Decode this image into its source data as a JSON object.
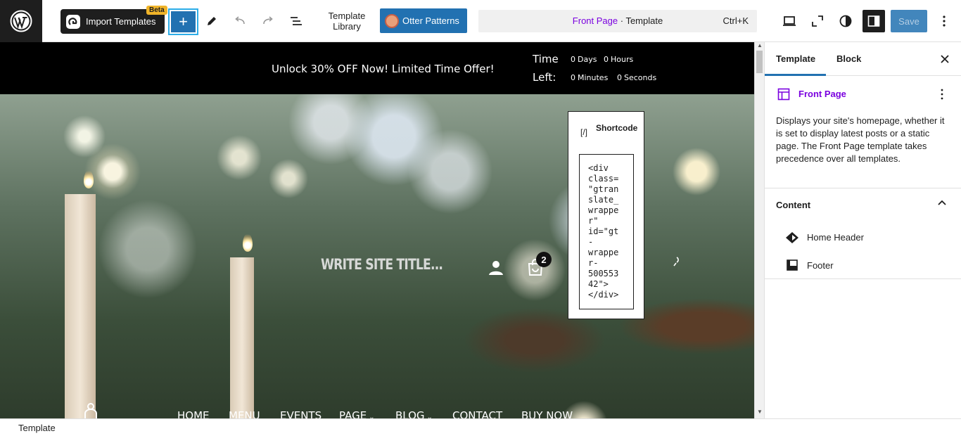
{
  "toolbar": {
    "import_label": "Import Templates",
    "beta_badge": "Beta",
    "template_library_line1": "Template",
    "template_library_line2": "Library",
    "otter_label": "Otter Patterns",
    "command": {
      "page": "Front Page",
      "separator": " · ",
      "type": "Template",
      "shortcut": "Ctrl+K"
    },
    "save_label": "Save"
  },
  "canvas": {
    "promo": {
      "message": "Unlock 30% OFF Now! Limited Time Offer!",
      "time_label_1": "Time",
      "time_label_2": "Left:",
      "days_value": "0",
      "days_label": "Days",
      "hours_value": "0",
      "hours_label": "Hours",
      "minutes_value": "0",
      "minutes_label": "Minutes",
      "seconds_value": "0",
      "seconds_label": "Seconds"
    },
    "site_title": "WRITE SITE TITLE...",
    "cart_count": "2",
    "nav": [
      "HOME",
      "MENU",
      "EVENTS",
      "PAGE",
      "BLOG",
      "CONTACT",
      "BUY NOW"
    ],
    "shortcode": {
      "icon": "[/]",
      "label": "Shortcode",
      "code_lines": [
        "<div",
        "class=",
        "\"gtran",
        "slate_",
        "wrappe",
        "r\"",
        "id=\"gt",
        "-",
        "wrappe",
        "r-",
        "500553",
        "42\">",
        "</div>"
      ]
    }
  },
  "sidebar": {
    "tabs": [
      "Template",
      "Block"
    ],
    "template_name": "Front Page",
    "description": "Displays your site's homepage, whether it is set to display latest posts or a static page. The Front Page template takes precedence over all templates.",
    "content_heading": "Content",
    "content_items": [
      "Home Header",
      "Footer"
    ]
  },
  "footer": {
    "breadcrumb": "Template"
  },
  "colors": {
    "accent": "#2271b1",
    "purple": "#7a00df",
    "dark": "#1e1e1e"
  }
}
